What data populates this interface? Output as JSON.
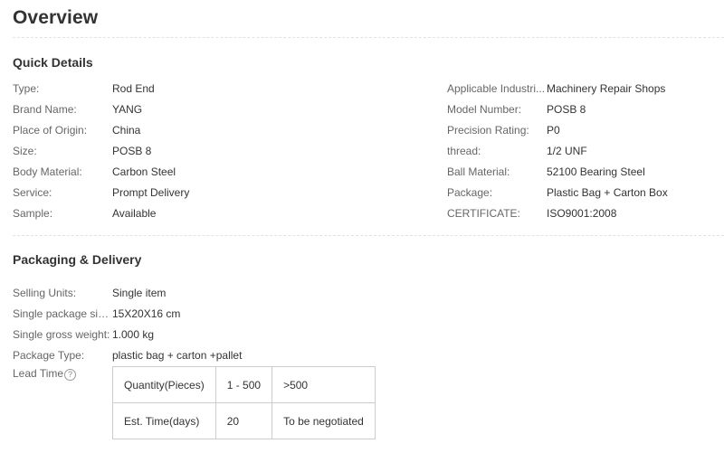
{
  "page_title": "Overview",
  "quick_details": {
    "title": "Quick Details",
    "left": [
      {
        "label": "Type:",
        "value": "Rod End"
      },
      {
        "label": "Brand Name:",
        "value": "YANG"
      },
      {
        "label": "Place of Origin:",
        "value": "China"
      },
      {
        "label": "Size:",
        "value": "POSB 8"
      },
      {
        "label": "Body Material:",
        "value": "Carbon Steel"
      },
      {
        "label": "Service:",
        "value": "Prompt Delivery"
      },
      {
        "label": "Sample:",
        "value": "Available"
      }
    ],
    "right": [
      {
        "label": "Applicable Industri...",
        "value": "Machinery Repair Shops"
      },
      {
        "label": "Model Number:",
        "value": "POSB 8"
      },
      {
        "label": "Precision Rating:",
        "value": "P0"
      },
      {
        "label": "thread:",
        "value": "1/2 UNF"
      },
      {
        "label": "Ball Material:",
        "value": "52100 Bearing Steel"
      },
      {
        "label": "Package:",
        "value": "Plastic Bag + Carton Box"
      },
      {
        "label": "CERTIFICATE:",
        "value": "ISO9001:2008"
      }
    ]
  },
  "packaging": {
    "title": "Packaging & Delivery",
    "rows": [
      {
        "label": "Selling Units:",
        "value": "Single item"
      },
      {
        "label": "Single package size:",
        "value": "15X20X16 cm"
      },
      {
        "label": "Single gross weight:",
        "value": "1.000 kg"
      },
      {
        "label": "Package Type:",
        "value": "plastic bag + carton +pallet"
      }
    ],
    "lead_time": {
      "label": "Lead Time",
      "help_icon": "question-circle-icon",
      "table": [
        [
          "Quantity(Pieces)",
          "1 - 500",
          ">500"
        ],
        [
          "Est. Time(days)",
          "20",
          "To be negotiated"
        ]
      ]
    }
  }
}
